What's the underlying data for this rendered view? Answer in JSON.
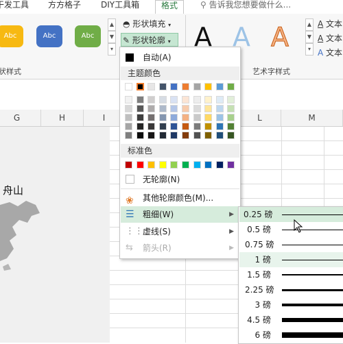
{
  "tabs": [
    {
      "label": "干发工具"
    },
    {
      "label": "方方格子"
    },
    {
      "label": "DIY工具箱"
    },
    {
      "label": "格式"
    }
  ],
  "tell_me": "告诉我您想要做什么...",
  "ribbon": {
    "shape_styles": [
      {
        "label": "Abc",
        "color": "#f7b912"
      },
      {
        "label": "Abc",
        "color": "#4472c4"
      },
      {
        "label": "Abc",
        "color": "#70ad47"
      }
    ],
    "fill_label": "形状填充",
    "outline_label": "形状轮廓",
    "shape_style_group": "状样式",
    "art_letters": [
      "A",
      "A",
      "A"
    ],
    "text_fill_label": "文本",
    "text_outline_label": "文本",
    "text_effects_label": "文本",
    "art_group": "艺术字样式"
  },
  "columns": [
    "G",
    "H",
    "I",
    "",
    "L",
    "M"
  ],
  "map": {
    "label": "舟山"
  },
  "menu": {
    "auto_label": "自动(A)",
    "theme_colors_label": "主题颜色",
    "theme_colors": [
      [
        "#ffffff",
        "#000000",
        "#e7e6e6",
        "#44546a",
        "#4472c4",
        "#ed7d31",
        "#a5a5a5",
        "#ffc000",
        "#5b9bd5",
        "#70ad47"
      ],
      [
        "#f2f2f2",
        "#7f7f7f",
        "#d0cece",
        "#d6dce4",
        "#d9e2f3",
        "#fbe5d5",
        "#ededed",
        "#fff2cc",
        "#deebf6",
        "#e2efd9"
      ],
      [
        "#d8d8d8",
        "#595959",
        "#aeabab",
        "#adb9ca",
        "#b4c6e7",
        "#f7cbac",
        "#dbdbdb",
        "#fee599",
        "#bdd7ee",
        "#c5e0b3"
      ],
      [
        "#bfbfbf",
        "#3f3f3f",
        "#757070",
        "#8496b0",
        "#8eaadb",
        "#f4b183",
        "#c9c9c9",
        "#ffd965",
        "#9cc3e5",
        "#a8d08d"
      ],
      [
        "#a5a5a5",
        "#262626",
        "#3a3838",
        "#323f4f",
        "#2f5496",
        "#c55a11",
        "#7b7b7b",
        "#bf9000",
        "#2e75b5",
        "#538135"
      ],
      [
        "#7f7f7f",
        "#0c0c0c",
        "#171616",
        "#222a35",
        "#1f3864",
        "#833c0b",
        "#525252",
        "#7f6000",
        "#1f4e79",
        "#375623"
      ]
    ],
    "standard_colors_label": "标准色",
    "standard_colors": [
      "#c00000",
      "#ff0000",
      "#ffc000",
      "#ffff00",
      "#92d050",
      "#00b050",
      "#00b0f0",
      "#0070c0",
      "#002060",
      "#7030a0"
    ],
    "no_outline_label": "无轮廓(N)",
    "more_colors_label": "其他轮廓颜色(M)...",
    "weight_label": "粗细(W)",
    "dashes_label": "虚线(S)",
    "arrows_label": "箭头(R)"
  },
  "weights": [
    {
      "label": "0.25 磅",
      "pt": 0.25
    },
    {
      "label": "0.5 磅",
      "pt": 0.5
    },
    {
      "label": "0.75 磅",
      "pt": 0.75
    },
    {
      "label": "1 磅",
      "pt": 1
    },
    {
      "label": "1.5 磅",
      "pt": 1.5
    },
    {
      "label": "2.25 磅",
      "pt": 2.25
    },
    {
      "label": "3 磅",
      "pt": 3
    },
    {
      "label": "4.5 磅",
      "pt": 4.5
    },
    {
      "label": "6 磅",
      "pt": 6
    }
  ]
}
